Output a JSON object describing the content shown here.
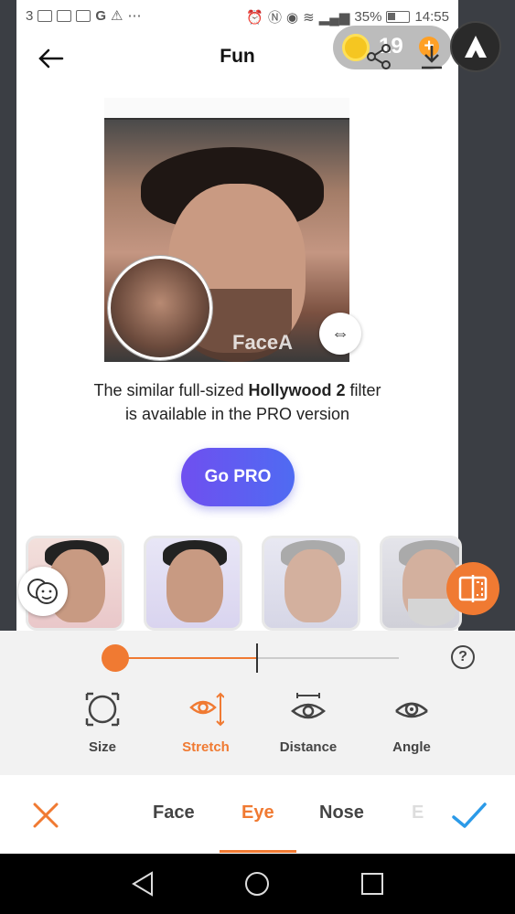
{
  "statusbar": {
    "left_text": "3",
    "battery": "35%",
    "time": "14:55"
  },
  "header": {
    "title": "Fun",
    "coins": "19"
  },
  "preview": {
    "watermark": "FaceA"
  },
  "promo": {
    "line1_prefix": "The similar full-sized ",
    "filter_name": "Hollywood 2",
    "line1_suffix": " filter",
    "line2": "is available in the PRO version"
  },
  "gopro_label": "Go PRO",
  "slider": {
    "value": 0.0,
    "help_label": "?"
  },
  "tools": [
    {
      "label": "Size",
      "icon": "size-icon",
      "active": false
    },
    {
      "label": "Stretch",
      "icon": "stretch-icon",
      "active": true
    },
    {
      "label": "Distance",
      "icon": "distance-icon",
      "active": false
    },
    {
      "label": "Angle",
      "icon": "angle-icon",
      "active": false
    }
  ],
  "tabs": [
    {
      "label": "Face",
      "active": false
    },
    {
      "label": "Eye",
      "active": true
    },
    {
      "label": "Nose",
      "active": false
    },
    {
      "label": "E",
      "active": false
    }
  ],
  "colors": {
    "accent": "#f07a32",
    "gopro_start": "#6f4ff0",
    "gopro_end": "#4f6bf2",
    "confirm": "#2b9ae8"
  }
}
